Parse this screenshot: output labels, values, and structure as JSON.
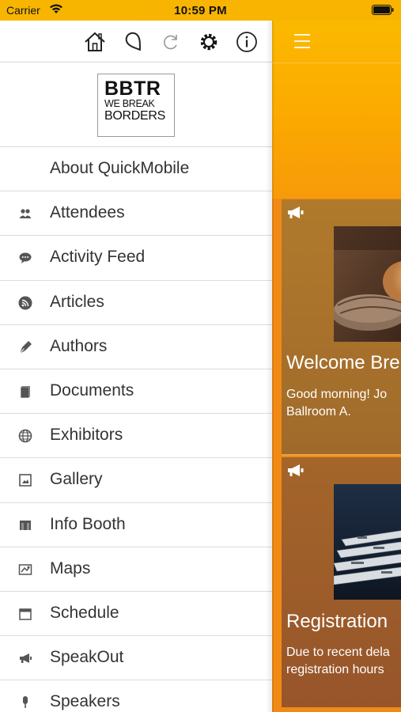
{
  "status_bar": {
    "carrier": "Carrier",
    "time": "10:59 PM"
  },
  "toolbar": {
    "icons": [
      "home-icon",
      "map-pin-icon",
      "refresh-icon",
      "settings-icon",
      "info-icon"
    ]
  },
  "logo": {
    "title": "BBTR",
    "line1": "WE BREAK",
    "line2": "BORDERS"
  },
  "menu": {
    "items": [
      {
        "label": "About QuickMobile",
        "icon": ""
      },
      {
        "label": "Attendees",
        "icon": "people-icon"
      },
      {
        "label": "Activity Feed",
        "icon": "chat-bubble-icon"
      },
      {
        "label": "Articles",
        "icon": "rss-icon"
      },
      {
        "label": "Authors",
        "icon": "pen-nib-icon"
      },
      {
        "label": "Documents",
        "icon": "document-icon"
      },
      {
        "label": "Exhibitors",
        "icon": "globe-icon"
      },
      {
        "label": "Gallery",
        "icon": "picture-icon"
      },
      {
        "label": "Info Booth",
        "icon": "booth-icon"
      },
      {
        "label": "Maps",
        "icon": "map-icon"
      },
      {
        "label": "Schedule",
        "icon": "calendar-icon"
      },
      {
        "label": "SpeakOut",
        "icon": "megaphone-icon"
      },
      {
        "label": "Speakers",
        "icon": "microphone-icon"
      }
    ]
  },
  "main": {
    "cards": [
      {
        "icon": "megaphone-icon",
        "title": "Welcome Bre",
        "text_line1": "Good morning! Jo",
        "text_line2": "Ballroom A."
      },
      {
        "icon": "megaphone-icon",
        "title": "Registration",
        "text_line1": "Due to recent dela",
        "text_line2": "registration hours"
      }
    ]
  },
  "colors": {
    "accent_yellow": "#fbb900",
    "accent_orange": "#f08a15",
    "card_brown": "#a06a2b"
  }
}
